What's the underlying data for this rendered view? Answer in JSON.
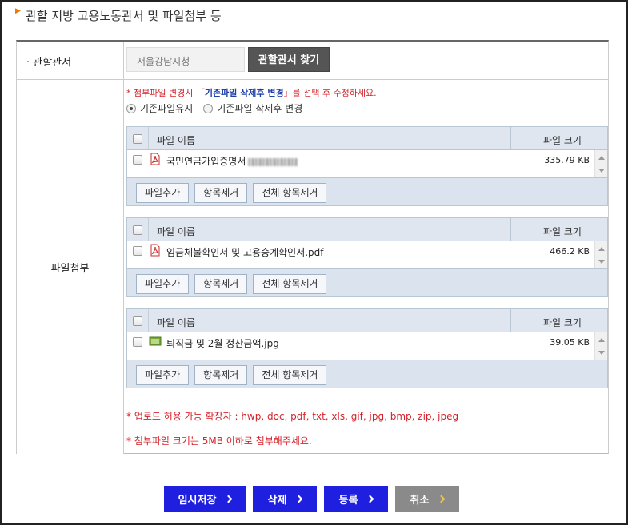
{
  "section": {
    "title": "관할 지방 고용노동관서 및 파일첨부 등"
  },
  "office": {
    "label": "· 관할관서",
    "value": "서울강남지청",
    "find_button": "관할관서 찾기"
  },
  "files": {
    "label": "파일첨부",
    "notice_prefix": "* 첨부파일 변경시 「",
    "notice_highlight": "기존파일 삭제후 변경",
    "notice_suffix": "」를 선택 후 수정하세요.",
    "radio_keep": "기존파일유지",
    "radio_replace": "기존파일 삭제후 변경",
    "selected_option": "기존파일유지",
    "uploaders": [
      {
        "col_name": "파일 이름",
        "col_size": "파일 크기",
        "file_name": "국민연금가입증명서",
        "file_type_icon": "pdf-icon",
        "file_size": "335.79 KB",
        "btn_add": "파일추가",
        "btn_remove": "항목제거",
        "btn_remove_all": "전체 항목제거"
      },
      {
        "col_name": "파일 이름",
        "col_size": "파일 크기",
        "file_name": "임금체불확인서 및 고용승계확인서.pdf",
        "file_type_icon": "pdf-icon",
        "file_size": "466.2 KB",
        "btn_add": "파일추가",
        "btn_remove": "항목제거",
        "btn_remove_all": "전체 항목제거"
      },
      {
        "col_name": "파일 이름",
        "col_size": "파일 크기",
        "file_name": "퇴직금 및 2월 정산금액.jpg",
        "file_type_icon": "jpg-icon",
        "file_size": "39.05 KB",
        "btn_add": "파일추가",
        "btn_remove": "항목제거",
        "btn_remove_all": "전체 항목제거"
      }
    ],
    "notice_ext": "* 업로드 허용 가능 확장자 : hwp, doc, pdf, txt, xls, gif, jpg, bmp, zip, jpeg",
    "notice_size": "* 첨부파일 크기는 5MB 이하로 첨부해주세요."
  },
  "actions": {
    "temp_save": "임시저장",
    "delete": "삭제",
    "register": "등록",
    "cancel": "취소"
  },
  "colors": {
    "primary_button": "#1f1fe0",
    "cancel_button": "#8a8a8a",
    "notice_red": "#d3232b",
    "notice_highlight_blue": "#1f3fa8",
    "title_marker": "#f07800"
  }
}
